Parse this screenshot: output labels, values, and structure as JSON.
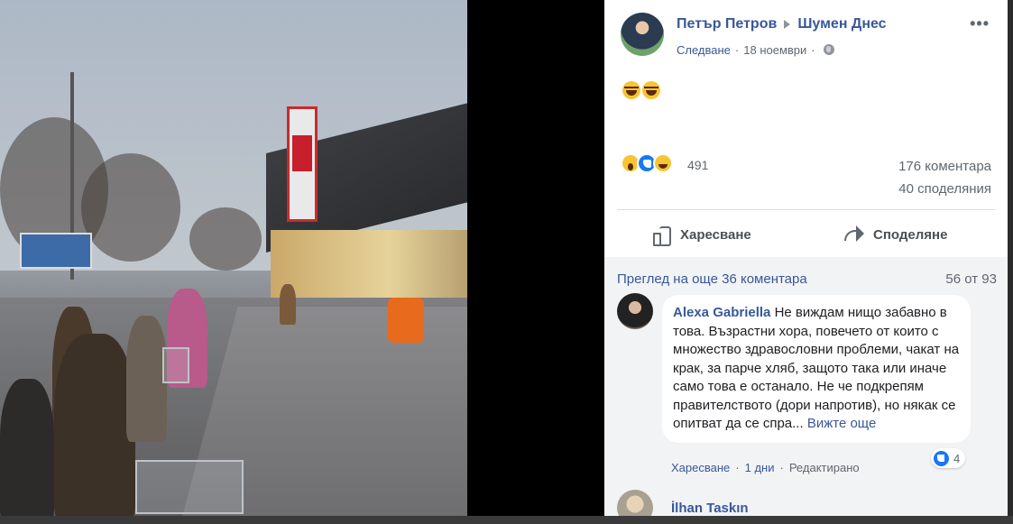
{
  "post": {
    "author": "Петър Петров",
    "group": "Шумен Днес",
    "follow": "Следване",
    "date": "18 ноември",
    "more": "•••",
    "reaction_count": "491",
    "comments_count": "176 коментара",
    "shares_count": "40 споделяния",
    "like_label": "Харесване",
    "share_label": "Споделяне"
  },
  "comments": {
    "view_more": "Преглед на още 36 коментара",
    "page": "56 от 93",
    "items": [
      {
        "author": "Alexa Gabriella",
        "text": "Не виждам нищо забавно в това. Възрастни хора, повечето от които с множество здравословни проблеми, чакат на крак, за парче хляб, защото така или иначе само това е останало. Не че подкрепям правителството (дори напротив), но някак се опитват да се спра...",
        "see_more": "Вижте още",
        "like": "Харесване",
        "time": "1 дни",
        "edited": "Редактирано",
        "reactions": "4"
      },
      {
        "author": "İlhan Taskın"
      }
    ]
  },
  "icons": {
    "reactions": [
      "wow-icon",
      "like-icon",
      "haha-icon"
    ],
    "post_emoji": [
      "laughing-face-icon",
      "laughing-face-icon"
    ]
  },
  "colors": {
    "link": "#385898",
    "like_blue": "#1877f2",
    "comment_bg": "#f2f3f5"
  }
}
